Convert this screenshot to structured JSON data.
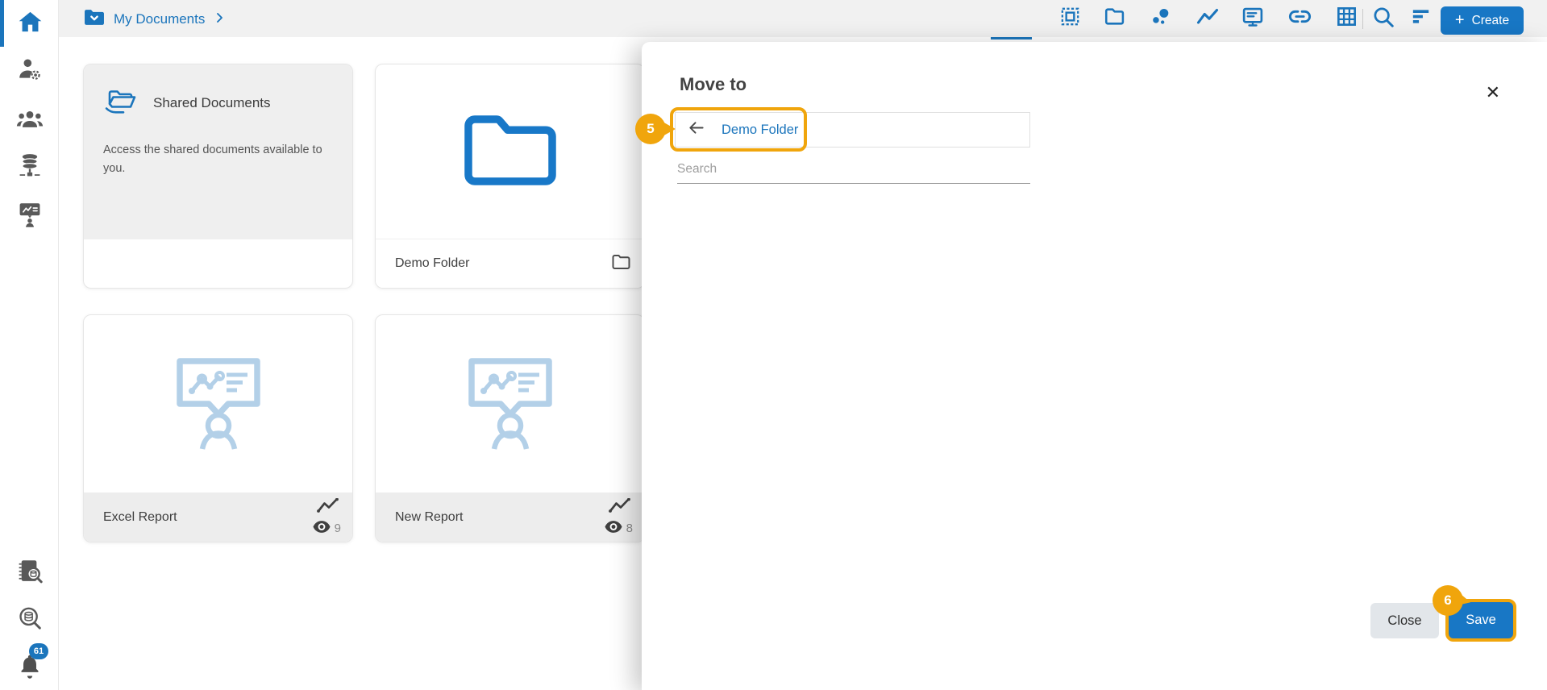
{
  "colors": {
    "primary_blue": "#1b75bc",
    "button_blue": "#1877c5",
    "annotation_orange": "#f0a50c",
    "card_gray": "#efefef",
    "footer_gray": "#ededed",
    "icon_gray": "#595959"
  },
  "sidebar": {
    "nav_icons": [
      "home",
      "user-settings",
      "people",
      "database-network",
      "report-presentation"
    ],
    "tool_icons": [
      "notebook-search",
      "database-search",
      "notification-bell"
    ],
    "notification_badge": "61"
  },
  "breadcrumb": {
    "label": "My Documents"
  },
  "toolbar": {
    "icons": [
      "select-grid",
      "folder",
      "bubble-chart",
      "line-chart",
      "presentation",
      "link",
      "table-grid",
      "search",
      "sort"
    ],
    "create_plus": "+",
    "create_label": "Create"
  },
  "cards": {
    "shared": {
      "title": "Shared Documents",
      "description": "Access the shared documents available to you."
    },
    "demo_folder": {
      "label": "Demo Folder"
    },
    "excel_report": {
      "label": "Excel Report",
      "views": "9"
    },
    "new_report": {
      "label": "New Report",
      "views": "8"
    }
  },
  "modal": {
    "title": "Move to",
    "close_icon": "✕",
    "back_target": "Demo Folder",
    "search_placeholder": "Search",
    "close_button": "Close",
    "save_button": "Save"
  },
  "annotations": {
    "step_5": "5",
    "step_6": "6"
  }
}
